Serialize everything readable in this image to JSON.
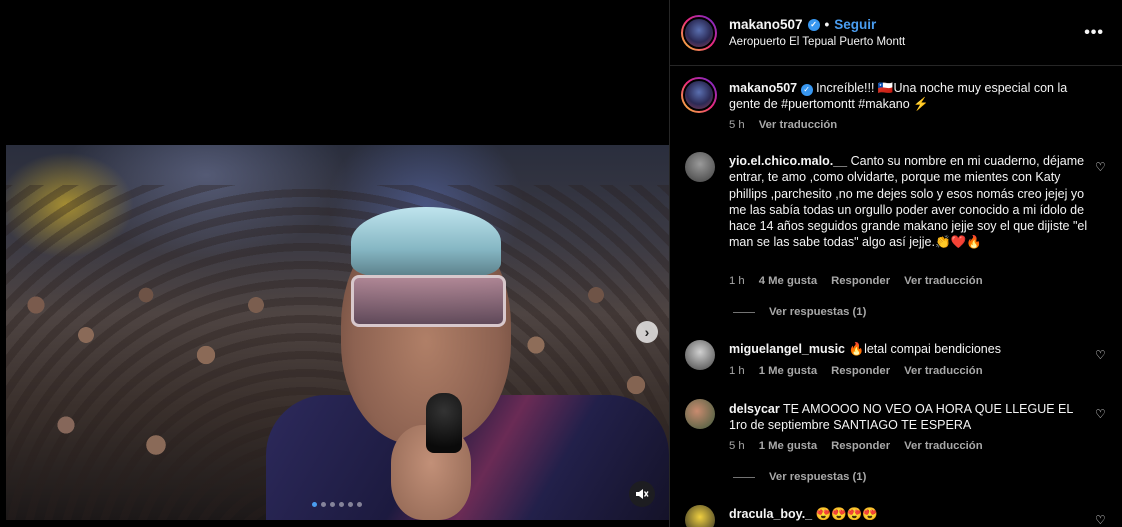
{
  "post": {
    "username": "makano507",
    "separator": "•",
    "follow_label": "Seguir",
    "location": "Aeropuerto El Tepual Puerto Montt",
    "more_icon": "more-horizontal-icon",
    "caption": "Increíble!!! 🇨🇱Una noche muy especial con la gente de #puertomontt #makano ⚡",
    "caption_time": "5 h",
    "caption_translate": "Ver traducción",
    "carousel": {
      "total_slides": 6,
      "active_index": 0
    }
  },
  "comments": [
    {
      "username": "yio.el.chico.malo.__",
      "text": "Canto su nombre en mi cuaderno, déjame entrar, te amo ,como olvidarte, porque me mientes con Katy phillips ,parchesito ,no me dejes solo y esos nomás creo jejej yo me las sabía todas un orgullo poder aver conocido a mi ídolo de hace 14 años seguidos grande makano jejje soy el que dijiste \"el man se las sabe todas\" algo así jejje.👏❤️🔥",
      "time": "1 h",
      "likes": "4 Me gusta",
      "reply": "Responder",
      "translate": "Ver traducción",
      "replies_label": "Ver respuestas (1)"
    },
    {
      "username": "miguelangel_music",
      "text": "🔥letal compai bendiciones",
      "time": "1 h",
      "likes": "1 Me gusta",
      "reply": "Responder",
      "translate": "Ver traducción"
    },
    {
      "username": "delsycar",
      "text": "TE AMOOOO NO VEO OA HORA QUE LLEGUE EL 1ro de septiembre SANTIAGO TE ESPERA",
      "time": "5 h",
      "likes": "1 Me gusta",
      "reply": "Responder",
      "translate": "Ver traducción",
      "replies_label": "Ver respuestas (1)"
    },
    {
      "username": "dracula_boy._",
      "text": "😍😍😍😍"
    }
  ],
  "colors": {
    "accent": "#4a9df0",
    "verified": "#3897f0",
    "muted": "#a8a8a8",
    "background": "#000000"
  }
}
